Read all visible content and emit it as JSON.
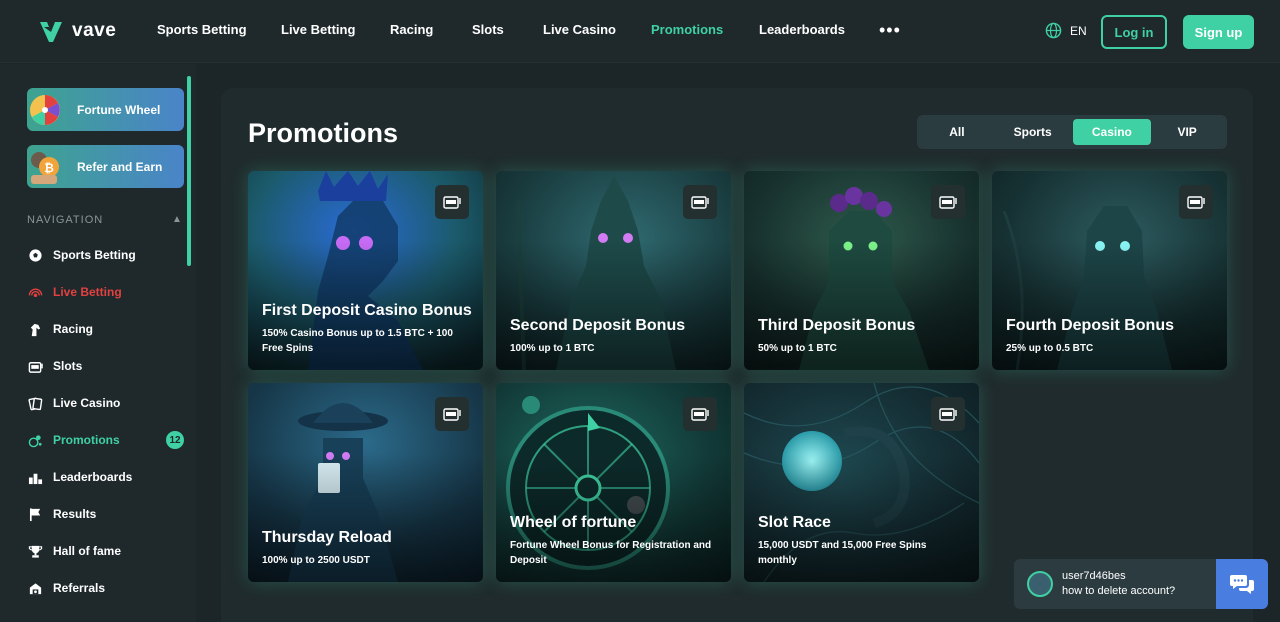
{
  "header": {
    "logo_text": "vave",
    "nav": [
      "Sports Betting",
      "Live Betting",
      "Racing",
      "Slots",
      "Live Casino",
      "Promotions",
      "Leaderboards"
    ],
    "more_label": "•••",
    "language": "EN",
    "login_label": "Log in",
    "signup_label": "Sign up"
  },
  "sidebar": {
    "fortune_wheel_label": "Fortune Wheel",
    "refer_label": "Refer and Earn",
    "nav_heading": "NAVIGATION",
    "items": [
      {
        "label": "Sports Betting",
        "icon": "soccer-ball-icon"
      },
      {
        "label": "Live Betting",
        "icon": "live-signal-icon"
      },
      {
        "label": "Racing",
        "icon": "horse-icon"
      },
      {
        "label": "Slots",
        "icon": "slot-machine-icon"
      },
      {
        "label": "Live Casino",
        "icon": "cards-icon"
      },
      {
        "label": "Promotions",
        "icon": "gift-icon"
      },
      {
        "label": "Leaderboards",
        "icon": "leaderboard-icon"
      },
      {
        "label": "Results",
        "icon": "flag-icon"
      },
      {
        "label": "Hall of fame",
        "icon": "trophy-icon"
      },
      {
        "label": "Referrals",
        "icon": "referral-icon"
      }
    ],
    "promotions_badge": "12"
  },
  "main": {
    "title": "Promotions",
    "filters": [
      "All",
      "Sports",
      "Casino",
      "VIP"
    ],
    "selected_filter": "Casino",
    "cards": [
      {
        "title": "First Deposit Casino Bonus",
        "subtitle": "150% Casino Bonus up to 1.5 BTC + 100 Free Spins"
      },
      {
        "title": "Second Deposit Bonus",
        "subtitle": "100% up to 1 BTC"
      },
      {
        "title": "Third Deposit Bonus",
        "subtitle": "50% up to 1 BTC"
      },
      {
        "title": "Fourth Deposit Bonus",
        "subtitle": "25% up to 0.5 BTC"
      },
      {
        "title": "Thursday Reload",
        "subtitle": "100% up to 2500 USDT"
      },
      {
        "title": "Wheel of fortune",
        "subtitle": "Fortune Wheel Bonus for Registration and Deposit"
      },
      {
        "title": "Slot Race",
        "subtitle": "15,000 USDT and 15,000 Free Spins monthly"
      }
    ]
  },
  "chat": {
    "user": "user7d46bes",
    "message": "how to delete account?"
  },
  "colors": {
    "accent": "#3fd1a4",
    "live": "#e2413f",
    "background": "#1c2628",
    "panel": "#202b2e",
    "chat_button": "#4a7de0"
  }
}
